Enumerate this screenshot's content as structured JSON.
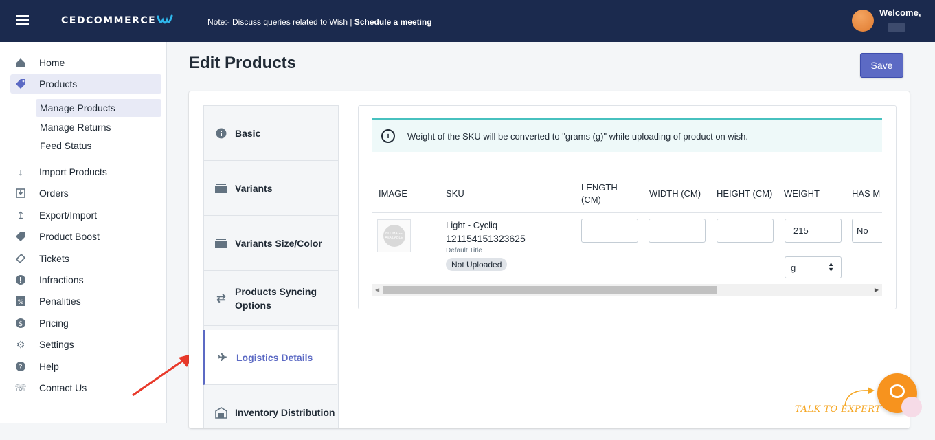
{
  "header": {
    "brand": "CEDCOMMERCE",
    "note_prefix": "Note:- Discuss queries related to Wish | ",
    "note_link": "Schedule a meeting",
    "welcome": "Welcome,"
  },
  "sidebar": {
    "items": [
      {
        "label": "Home",
        "icon": "home-icon"
      },
      {
        "label": "Products",
        "icon": "tag-icon",
        "active": true
      },
      {
        "label": "Import Products",
        "icon": "download-arrow-icon"
      },
      {
        "label": "Orders",
        "icon": "inbox-icon"
      },
      {
        "label": "Export/Import",
        "icon": "upload-arrow-icon"
      },
      {
        "label": "Product Boost",
        "icon": "tag-icon"
      },
      {
        "label": "Tickets",
        "icon": "ticket-icon"
      },
      {
        "label": "Infractions",
        "icon": "alert-circle-icon"
      },
      {
        "label": "Penalities",
        "icon": "percent-icon"
      },
      {
        "label": "Pricing",
        "icon": "dollar-icon"
      },
      {
        "label": "Settings",
        "icon": "gear-icon"
      },
      {
        "label": "Help",
        "icon": "question-icon"
      },
      {
        "label": "Contact Us",
        "icon": "phone-icon"
      }
    ],
    "sub_items": [
      {
        "label": "Manage Products",
        "active": true
      },
      {
        "label": "Manage Returns"
      },
      {
        "label": "Feed Status"
      }
    ]
  },
  "main": {
    "title": "Edit Products",
    "save_label": "Save",
    "tabs": [
      {
        "label": "Basic",
        "icon": "info-icon"
      },
      {
        "label": "Variants",
        "icon": "stack-icon"
      },
      {
        "label": "Variants Size/Color",
        "icon": "stack-icon"
      },
      {
        "label": "Products Syncing Options",
        "icon": "sync-icon"
      },
      {
        "label": "Logistics Details",
        "icon": "airplane-icon",
        "active": true
      },
      {
        "label": "Inventory Distribution",
        "icon": "warehouse-icon"
      }
    ],
    "banner": "Weight of the SKU will be converted to \"grams (g)\" while uploading of product on wish.",
    "table": {
      "headers": [
        "IMAGE",
        "SKU",
        "LENGTH (CM)",
        "WIDTH (CM)",
        "HEIGHT (CM)",
        "WEIGHT",
        "HAS M"
      ],
      "row": {
        "image_alt": "NO IMAGE AVAILABLE",
        "sku_name": "Light - Cycliq",
        "sku_id": "121154151323625",
        "variant_title": "Default Title",
        "status": "Not Uploaded",
        "length": "",
        "width": "",
        "height": "",
        "weight": "215",
        "weight_unit": "g",
        "has_m": "No"
      }
    }
  },
  "chat": {
    "label": "TALK TO EXPERT"
  },
  "colors": {
    "topbar": "#1b2a4e",
    "accent": "#5c6ac4",
    "banner_border": "#47c1bf",
    "chat": "#f7931e"
  }
}
